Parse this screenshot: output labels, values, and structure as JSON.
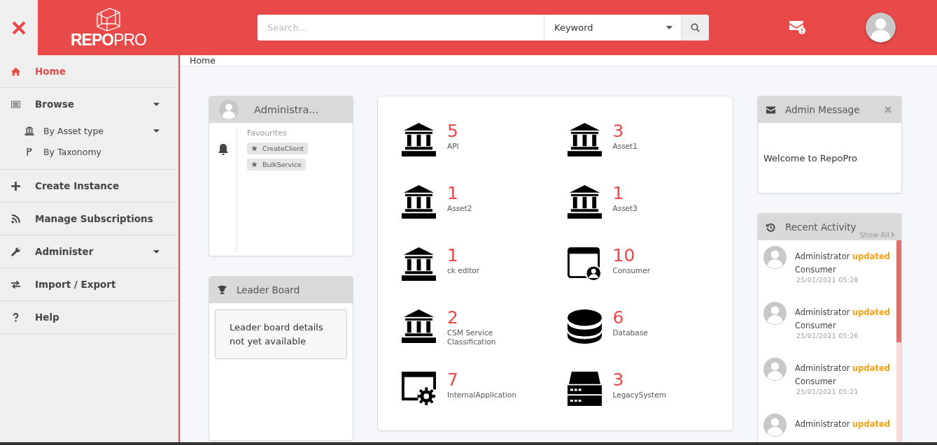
{
  "header": {
    "logo_bold": "REPO",
    "logo_light": "PRO",
    "search": {
      "placeholder": "Search..."
    },
    "search_type": "Keyword"
  },
  "sidebar": {
    "items": [
      {
        "label": "Home",
        "kind": "home",
        "selected": true,
        "dropdown": false
      },
      {
        "label": "Browse",
        "kind": "list",
        "selected": false,
        "dropdown": true,
        "children": [
          {
            "label": "By Asset type",
            "kind": "bank",
            "dropdown": true
          },
          {
            "label": "By Taxonomy",
            "kind": "taxonomy",
            "dropdown": false
          }
        ]
      },
      {
        "label": "Create Instance",
        "kind": "plus",
        "selected": false,
        "dropdown": false
      },
      {
        "label": "Manage Subscriptions",
        "kind": "rss",
        "selected": false,
        "dropdown": false
      },
      {
        "label": "Administer",
        "kind": "wrench",
        "selected": false,
        "dropdown": true
      },
      {
        "label": "Import / Export",
        "kind": "exchange",
        "selected": false,
        "dropdown": false
      },
      {
        "label": "Help",
        "kind": "help",
        "selected": false,
        "dropdown": false
      }
    ]
  },
  "breadcrumb": "Home",
  "profile_card": {
    "name": "Administra...",
    "favourites_title": "Favourites",
    "favourites": [
      "CreateClient",
      "BulkService"
    ]
  },
  "leader_board": {
    "title": "Leader Board",
    "message": "Leader board details not yet available"
  },
  "assets": [
    {
      "count": "5",
      "name": "API",
      "kind": "bank"
    },
    {
      "count": "3",
      "name": "Asset1",
      "kind": "bank"
    },
    {
      "count": "1",
      "name": "Asset2",
      "kind": "bank"
    },
    {
      "count": "1",
      "name": "Asset3",
      "kind": "bank"
    },
    {
      "count": "1",
      "name": "ck editor",
      "kind": "bank"
    },
    {
      "count": "10",
      "name": "Consumer",
      "kind": "consumer"
    },
    {
      "count": "2",
      "name": "CSM Service Classification",
      "kind": "bank"
    },
    {
      "count": "6",
      "name": "Database",
      "kind": "database"
    },
    {
      "count": "7",
      "name": "InternalApplication",
      "kind": "app"
    },
    {
      "count": "3",
      "name": "LegacySystem",
      "kind": "server"
    }
  ],
  "admin_message": {
    "title": "Admin Message",
    "message": "Welcome to RepoPro"
  },
  "recent_activity": {
    "title": "Recent Activity",
    "show_all": "Show All",
    "items": [
      {
        "user": "Administrator",
        "action": "updated",
        "target": "Consumer",
        "time": "25/01/2021 05:28"
      },
      {
        "user": "Administrator",
        "action": "updated",
        "target": "Consumer",
        "time": "25/01/2021 05:26"
      },
      {
        "user": "Administrator",
        "action": "updated",
        "target": "Consumer",
        "time": "25/01/2021 05:21"
      },
      {
        "user": "Administrator",
        "action": "updated"
      }
    ]
  }
}
